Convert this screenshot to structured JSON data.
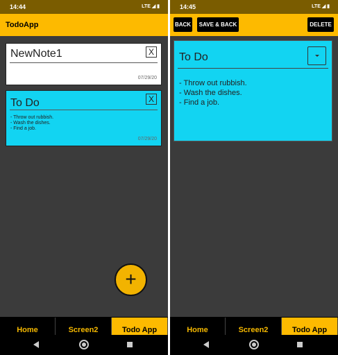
{
  "left": {
    "status": {
      "time": "14:44",
      "signal": "LTE"
    },
    "appbar": {
      "title": "TodoApp"
    },
    "notes": [
      {
        "title": "NewNote1",
        "close": "X",
        "body": "",
        "date": "07/29/20",
        "color": "#ffffff"
      },
      {
        "title": "To Do",
        "close": "X",
        "body": "- Throw out rubbish.\n- Wash the dishes.\n- Find a job.",
        "date": "07/29/20",
        "color": "#12d4f2"
      }
    ],
    "fab": "+"
  },
  "right": {
    "status": {
      "time": "14:45",
      "signal": "LTE"
    },
    "toolbar": {
      "back": "BACK",
      "save_back": "SAVE & BACK",
      "delete": "DELETE"
    },
    "editor": {
      "title": "To Do",
      "body": "- Throw out rubbish.\n- Wash the dishes.\n- Find a job.",
      "color": "#12d4f2"
    }
  },
  "nav": {
    "home": "Home",
    "screen2": "Screen2",
    "todo": "Todo App"
  },
  "colors": {
    "accent": "#fdba00",
    "status_bar": "#7a5c00",
    "background": "#3b3b3b",
    "note_cyan": "#12d4f2"
  }
}
